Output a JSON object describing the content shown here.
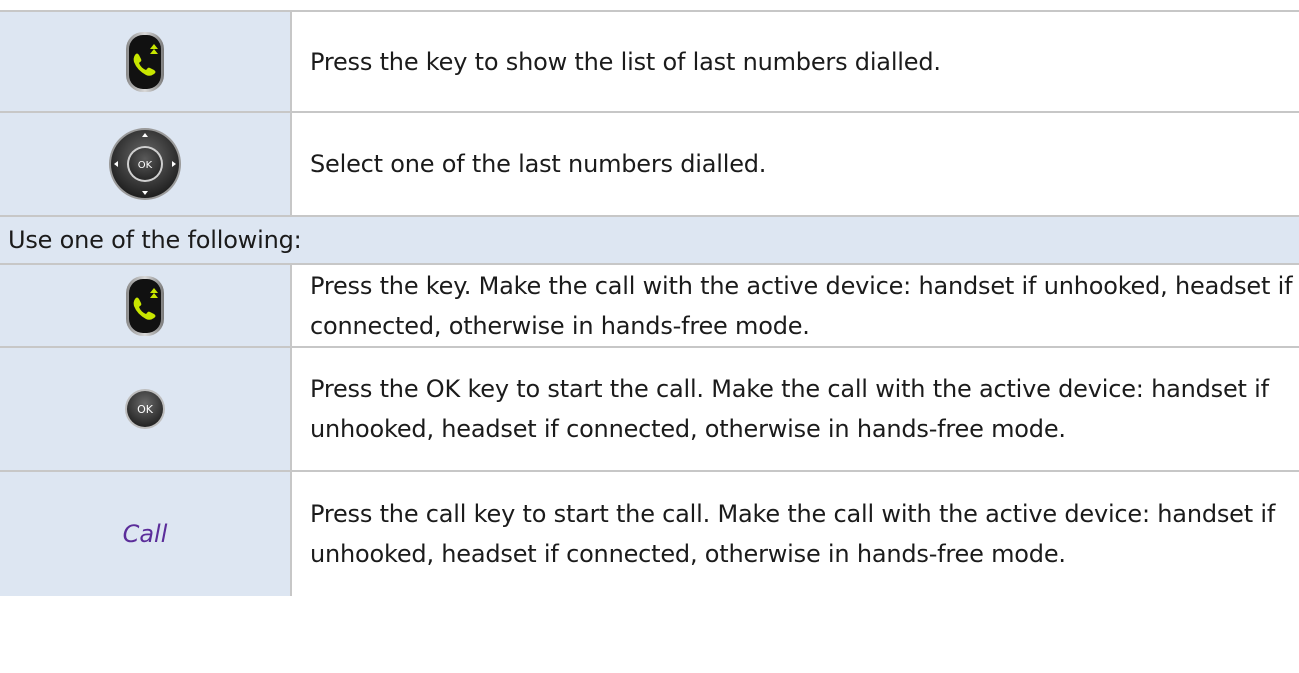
{
  "rows": [
    {
      "icon": "redial-key-icon",
      "text": "Press the key to show the list of last numbers dialled."
    },
    {
      "icon": "navigator-ok-icon",
      "text": "Select one of the last numbers dialled."
    }
  ],
  "section_header": "Use one of the following:",
  "options": [
    {
      "icon": "redial-key-icon",
      "text": "Press the key. Make the call with the active device: handset if unhooked, headset if connected, otherwise in hands-free mode."
    },
    {
      "icon": "ok-key-icon",
      "icon_label": "OK",
      "text": "Press the OK key to start the call. Make the call with the active device: handset if unhooked, headset if connected, otherwise in hands-free mode."
    },
    {
      "label": "Call",
      "label_color": "#5b2d9a",
      "text": "Press the call key to start the call. Make the call with the active device: handset if unhooked, headset if connected, otherwise in hands-free mode."
    }
  ],
  "navigator_label": "OK",
  "colors": {
    "icon_cell_bg": "#dde6f2",
    "border": "#c7c7c7",
    "key_green": "#c8e600",
    "call_label": "#5b2d9a"
  }
}
